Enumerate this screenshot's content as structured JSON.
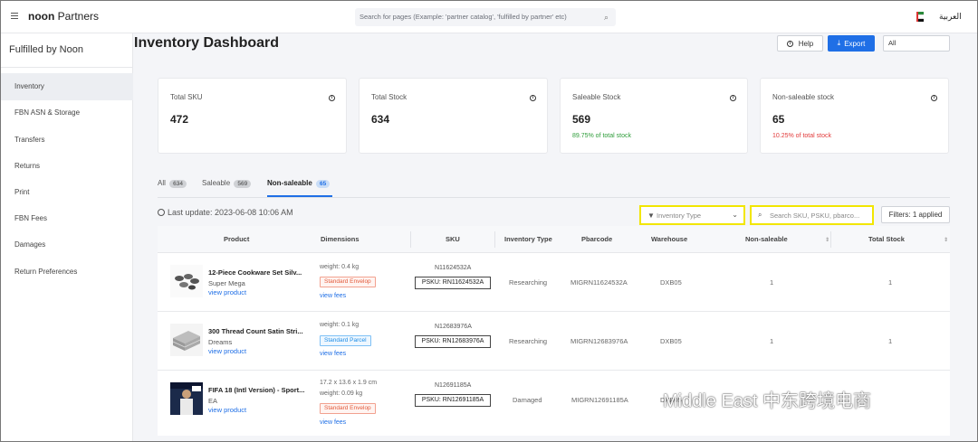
{
  "topbar": {
    "brand_bold": "noon",
    "brand_rest": " Partners",
    "search_placeholder": "Search for pages (Example: 'partner catalog', 'fulfilled by partner' etc)",
    "language": "العربية"
  },
  "sidebar": {
    "title": "Fulfilled by Noon",
    "items": [
      {
        "label": "Inventory",
        "active": true
      },
      {
        "label": "FBN ASN & Storage"
      },
      {
        "label": "Transfers"
      },
      {
        "label": "Returns"
      },
      {
        "label": "Print"
      },
      {
        "label": "FBN Fees"
      },
      {
        "label": "Damages"
      },
      {
        "label": "Return Preferences"
      }
    ]
  },
  "main": {
    "title": "Inventory Dashboard",
    "help_label": "Help",
    "export_label": "Export",
    "select_value": "All"
  },
  "stats": [
    {
      "label": "Total SKU",
      "value": "472",
      "sub": ""
    },
    {
      "label": "Total Stock",
      "value": "634",
      "sub": ""
    },
    {
      "label": "Saleable Stock",
      "value": "569",
      "sub": "89.75% of total stock",
      "sub_color": "#2e9d3a"
    },
    {
      "label": "Non-saleable stock",
      "value": "65",
      "sub": "10.25% of total stock",
      "sub_color": "#e23a3a"
    }
  ],
  "tabs": [
    {
      "label": "All",
      "count": "634"
    },
    {
      "label": "Saleable",
      "count": "569"
    },
    {
      "label": "Non-saleable",
      "count": "65",
      "active": true
    }
  ],
  "toolbar": {
    "last_update": "Last update: 2023-06-08 10:06 AM",
    "inventory_type_placeholder": "Inventory Type",
    "sku_search_placeholder": "Search SKU, PSKU, pbarco...",
    "filters_label": "Filters:",
    "filters_count": "1 applied"
  },
  "table": {
    "headers": [
      "Product",
      "Dimensions",
      "SKU",
      "Inventory Type",
      "Pbarcode",
      "Warehouse",
      "Non-saleable",
      "Total Stock"
    ],
    "rows": [
      {
        "name": "12-Piece Cookware Set Silv...",
        "brand": "Super Mega",
        "link": "view product",
        "dimensions": [
          "weight: 0.4 kg"
        ],
        "badge": "Standard Envelop",
        "badge_type": "envelop",
        "fees": "view fees",
        "sku": "N11624532A",
        "psku": "PSKU: RN11624532A",
        "inventory_type": "Researching",
        "pbarcode": "MIGRN11624532A",
        "warehouse": "DXB05",
        "non_saleable": "1",
        "total_stock": "1"
      },
      {
        "name": "300 Thread Count Satin Stri...",
        "brand": "Dreams",
        "link": "view product",
        "dimensions": [
          "weight: 0.1 kg"
        ],
        "badge": "Standard Parcel",
        "badge_type": "parcel",
        "fees": "view fees",
        "sku": "N12683976A",
        "psku": "PSKU: RN12683976A",
        "inventory_type": "Researching",
        "pbarcode": "MIGRN12683976A",
        "warehouse": "DXB05",
        "non_saleable": "1",
        "total_stock": "1"
      },
      {
        "name": "FIFA 18 (Intl Version) - Sport...",
        "brand": "EA",
        "link": "view product",
        "dimensions": [
          "17.2 x 13.6 x 1.9 cm",
          "weight: 0.09 kg"
        ],
        "badge": "Standard Envelop",
        "badge_type": "envelop",
        "fees": "view fees",
        "sku": "N12691185A",
        "psku": "PSKU: RN12691185A",
        "inventory_type": "Damaged",
        "pbarcode": "MIGRN12691185A",
        "warehouse": "DXB05",
        "non_saleable": "",
        "total_stock": ""
      }
    ]
  },
  "watermark": "Middle East 中东跨境电商",
  "colors": {
    "accent": "#1f6fe6",
    "highlight_border": "#f2e600"
  }
}
